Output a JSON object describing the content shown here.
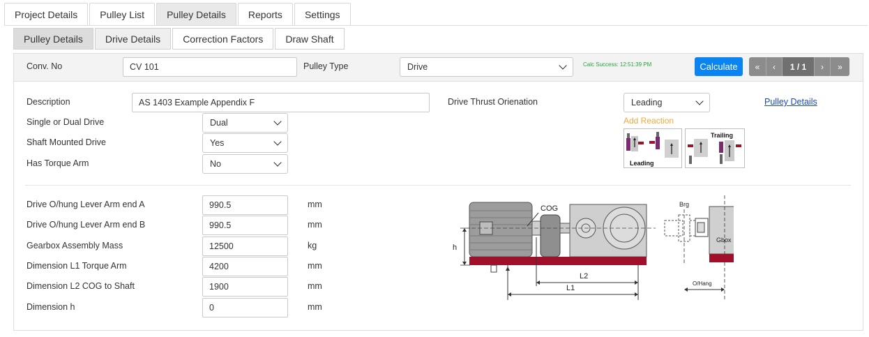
{
  "tabs": [
    "Project Details",
    "Pulley List",
    "Pulley Details",
    "Reports",
    "Settings"
  ],
  "subtabs": [
    "Pulley Details",
    "Drive Details",
    "Correction Factors",
    "Draw Shaft"
  ],
  "topbar": {
    "conv_no_label": "Conv. No",
    "conv_no_value": "CV 101",
    "pulley_type_label": "Pulley Type",
    "pulley_type_value": "Drive",
    "calc_status": "Calc Success: 12:51:39 PM",
    "calculate_label": "Calculate",
    "pager": {
      "first": "«",
      "prev": "‹",
      "page": "1 / 1",
      "next": "›",
      "last": "»"
    }
  },
  "form": {
    "description_label": "Description",
    "description_value": "AS 1403 Example Appendix F",
    "thrust_label": "Drive Thrust Orienation",
    "thrust_value": "Leading",
    "pulley_details_link": "Pulley Details",
    "add_reaction": "Add Reaction",
    "reaction_leading": "Leading",
    "reaction_trailing": "Trailing",
    "drive_type_label": "Single or Dual Drive",
    "drive_type_value": "Dual",
    "shaft_mounted_label": "Shaft Mounted Drive",
    "shaft_mounted_value": "Yes",
    "torque_arm_label": "Has Torque Arm",
    "torque_arm_value": "No"
  },
  "dims": [
    {
      "label": "Drive O/hung Lever Arm end A",
      "value": "990.5",
      "unit": "mm"
    },
    {
      "label": "Drive O/hung Lever Arm end B",
      "value": "990.5",
      "unit": "mm"
    },
    {
      "label": "Gearbox Assembly Mass",
      "value": "12500",
      "unit": "kg"
    },
    {
      "label": "Dimension L1 Torque Arm",
      "value": "4200",
      "unit": "mm"
    },
    {
      "label": "Dimension L2 COG to Shaft",
      "value": "1900",
      "unit": "mm"
    },
    {
      "label": "Dimension h",
      "value": "0",
      "unit": "mm"
    }
  ],
  "diagram": {
    "cog": "COG",
    "h": "h",
    "l1": "L1",
    "l2": "L2",
    "brg": "Brg",
    "gbox": "Gbox",
    "ohang": "O/Hang"
  },
  "colors": {
    "accent": "#0a84f0",
    "base_plate": "#a0102a",
    "success": "#22a33a",
    "link": "#1a45c9",
    "warning_text": "#f2a83b"
  }
}
